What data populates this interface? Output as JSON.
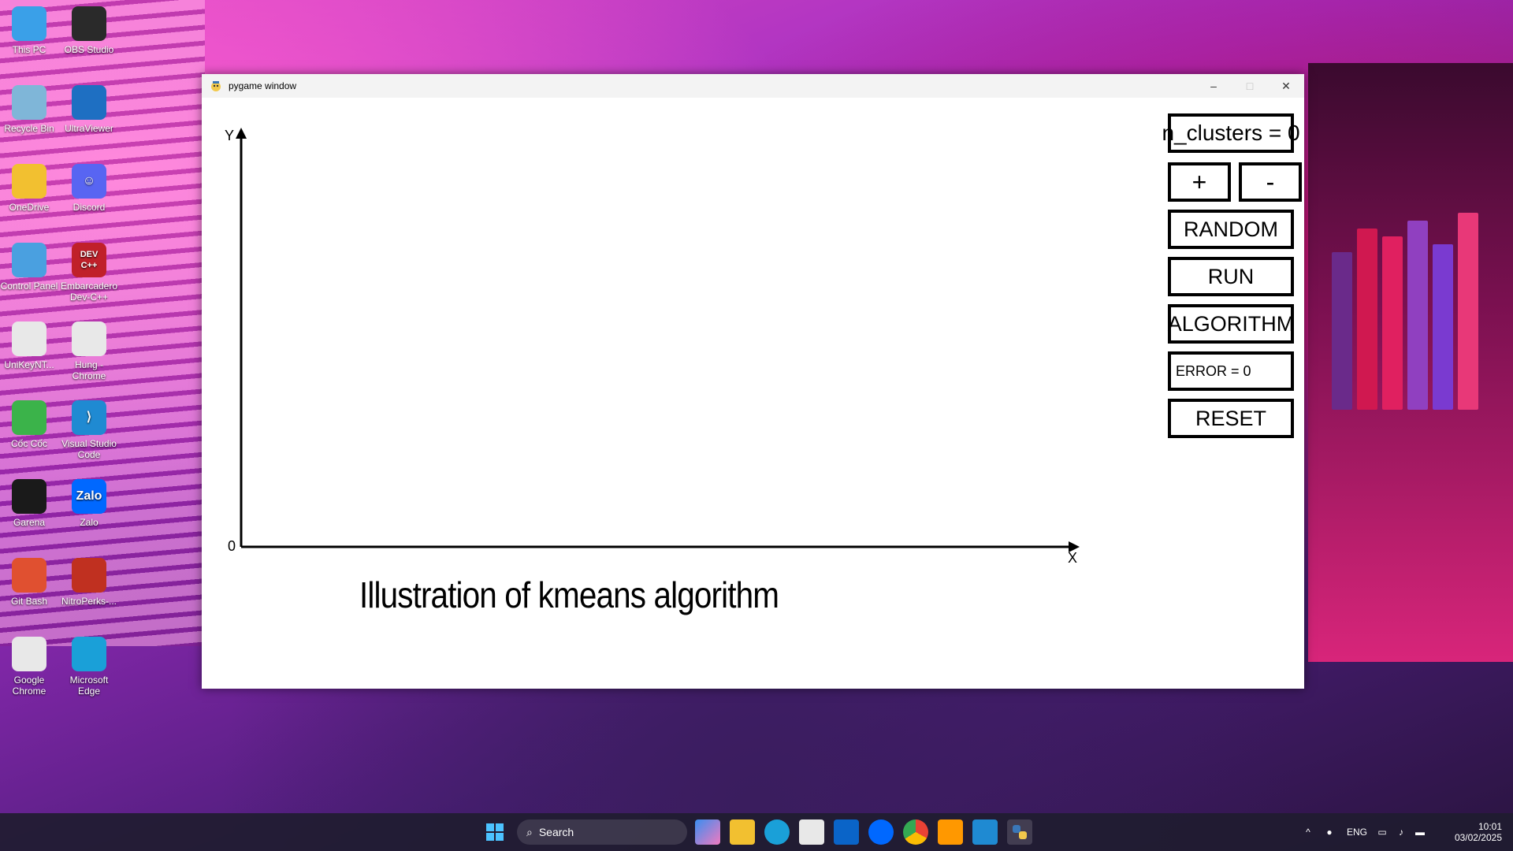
{
  "desktop": {
    "icons": [
      {
        "label": "This PC",
        "color": "#3aa0e8"
      },
      {
        "label": "OBS Studio",
        "color": "#2a2a2a"
      },
      {
        "label": "Recycle Bin",
        "color": "#7fb6d8"
      },
      {
        "label": "UltraViewer",
        "color": "#1e6fc2"
      },
      {
        "label": "OneDrive",
        "color": "#f2c030"
      },
      {
        "label": "Discord",
        "color": "#5865f2"
      },
      {
        "label": "Control Panel",
        "color": "#4aa0e0"
      },
      {
        "label": "Embarcadero Dev-C++",
        "color": "#c0202a"
      },
      {
        "label": "UniKeyNT...",
        "color": "#e8e8e8"
      },
      {
        "label": "Hung - Chrome",
        "color": "#e8e8e8"
      },
      {
        "label": "Cốc Cốc",
        "color": "#3bb34a"
      },
      {
        "label": "Visual Studio Code",
        "color": "#1f8ad2"
      },
      {
        "label": "Garena",
        "color": "#1a1a1a"
      },
      {
        "label": "Zalo",
        "color": "#0068ff"
      },
      {
        "label": "Git Bash",
        "color": "#e05030"
      },
      {
        "label": "NitroPerks-...",
        "color": "#c03020"
      },
      {
        "label": "Google Chrome",
        "color": "#e8e8e8"
      },
      {
        "label": "Microsoft Edge",
        "color": "#1aa0d8"
      }
    ],
    "icon_glyphs": {
      "Discord": "☺",
      "Embarcadero Dev-C++": "DEV C++",
      "Zalo": "Zalo",
      "Visual Studio Code": "⟩"
    }
  },
  "window": {
    "title": "pygame window",
    "minimize": "–",
    "maximize": "□",
    "close": "✕"
  },
  "plot": {
    "y_label": "Y",
    "x_label": "X",
    "origin_label": "0",
    "caption": "Illustration of kmeans algorithm"
  },
  "controls": {
    "n_clusters": "n_clusters = 0",
    "plus": "+",
    "minus": "-",
    "random": "RANDOM",
    "run": "RUN",
    "algorithm": "ALGORITHM",
    "error": "ERROR = 0",
    "reset": "RESET"
  },
  "taskbar": {
    "search_placeholder": "Search",
    "language": "ENG",
    "time": "10:01",
    "date": "03/02/2025"
  }
}
